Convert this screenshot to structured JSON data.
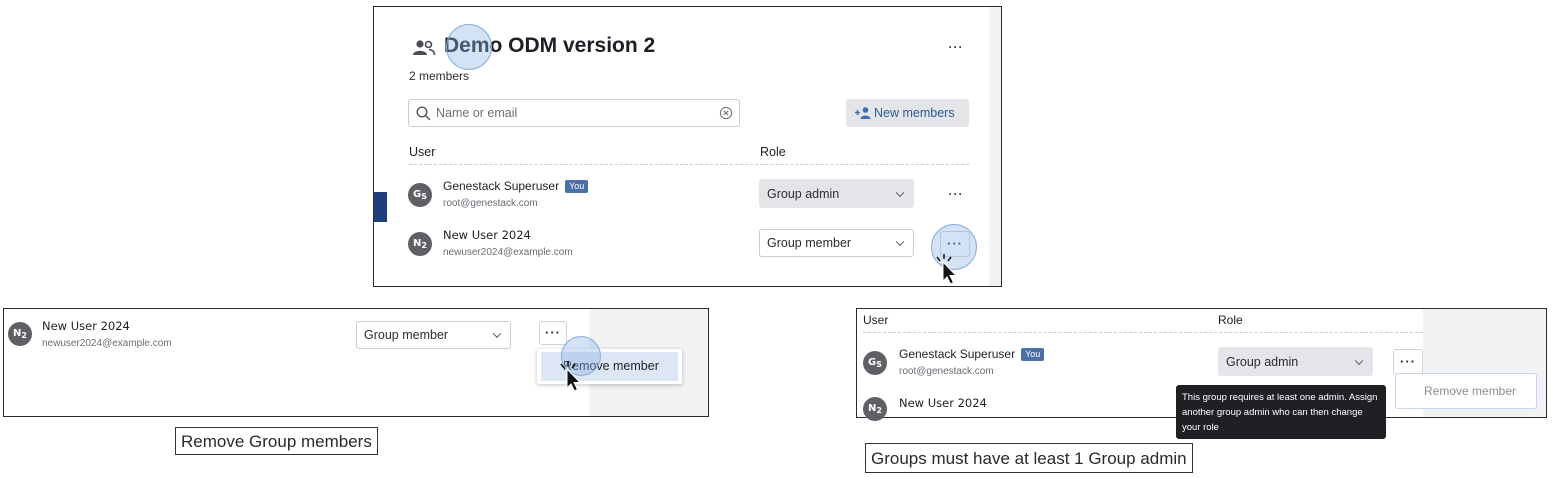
{
  "top_panel": {
    "group_title": "Demo ODM version 2",
    "member_count": "2 members",
    "search_placeholder": "Name or email",
    "new_members_label": "New members",
    "col_user": "User",
    "col_role": "Role",
    "more_label": "···",
    "members": [
      {
        "initial": "G",
        "sub": "S",
        "name": "Genestack Superuser",
        "you_badge": "You",
        "email": "root@genestack.com",
        "role": "Group admin"
      },
      {
        "initial": "N",
        "sub": "2",
        "name": "New User 2024",
        "email": "newuser2024@example.com",
        "role": "Group member"
      }
    ],
    "icons": {
      "group": "people-icon",
      "search": "search-icon",
      "clear": "clear-circle-icon",
      "add_user": "add-user-icon",
      "chevron": "chevron-down-icon"
    }
  },
  "left_panel": {
    "initial": "N",
    "sub": "2",
    "name": "New User 2024",
    "email": "newuser2024@example.com",
    "role": "Group member",
    "more_label": "···",
    "menu_item": "Remove member"
  },
  "right_panel": {
    "col_user": "User",
    "col_role": "Role",
    "initial": "G",
    "sub": "S",
    "name": "Genestack Superuser",
    "you_badge": "You",
    "email": "root@genestack.com",
    "role": "Group admin",
    "more_label": "···",
    "next_initial": "N",
    "next_sub": "2",
    "next_name": "New User 2024",
    "tooltip": "This group requires at least one admin. Assign another group admin who can then change your role",
    "menu_item": "Remove member"
  },
  "captions": {
    "left": "Remove Group members",
    "right": "Groups must have at least 1 Group admin"
  },
  "colors": {
    "badge": "#4a6fa5",
    "highlight": "#86aede",
    "tooltip_bg": "#1f2024",
    "sidebar_accent": "#1e3f7a"
  }
}
